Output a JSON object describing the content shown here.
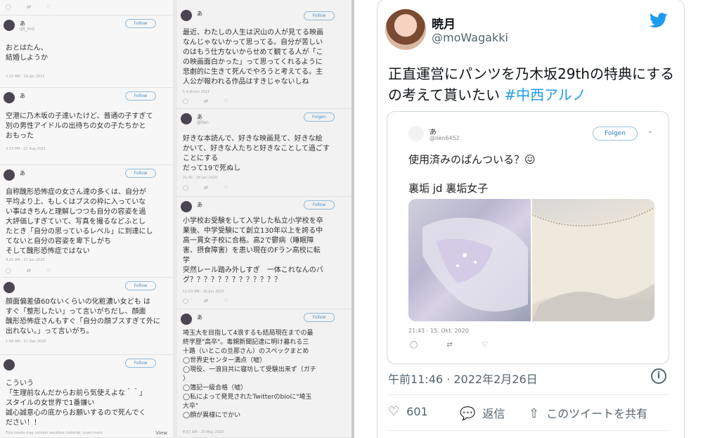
{
  "collage": {
    "col_a": [
      {
        "name": "あ",
        "handle": "@l_miz",
        "follow": "Follow",
        "text": "おとはたん、\n結婚しようか",
        "time": "2:22 AM - 19 Jan 2021"
      },
      {
        "name": "あ",
        "handle": "",
        "follow": "Follow",
        "text": "空港に乃木坂の子達いたけど、普通の子すぎて\n別の男性アイドルの出待ちの女の子たちかと\nおもった",
        "time": "3:13 PM - 22 Aug 2021"
      },
      {
        "name": "あ",
        "handle": "",
        "follow": "Follow",
        "text": "自称醜形恐怖症の女さん達の多くは、自分が\n平均より上、もしくはブスの枠に入っていな\nい事はきちんと理解しつつも自分の容姿を過\n大評価しすぎていて、写真を撮るなどふとし\nたとき「自分の思っているレベル」に到達にし\nてないと自分の容姿を卑下しがち\nそして醜形恐怖症ではない",
        "time": "9:25 AM - 17 Jun 2020"
      },
      {
        "name": "",
        "handle": "",
        "follow": "Follow",
        "text": "顔面偏差値60ないくらいの化粧濃い女ども は\nすぐ「整形したい」って言いがちだし、顔面\n醜形恐怖症さんもすぐ「自分の顔ブスすぎて外に\n出れない。」って言いがち。",
        "time": "1:58 AM - 21 Dec 2020"
      },
      {
        "name": "",
        "handle": "",
        "follow": "Follow",
        "text": "こういう\n「生理前なんだからお前ら気使えよな＾＾」\nスタイルの女世界で1番嫌い\n誠心誠意心の底からお願いするので死んでく\nださい！！",
        "time": "",
        "footer": "This media may contain sensitive material. Learn more",
        "footer_btn": "View"
      }
    ],
    "col_b": [
      {
        "name": "あ",
        "handle": "",
        "follow": "Follow",
        "text": "最近、わたしの人生は沢山の人が見てる映画\nなんじゃないかって思ってる。自分が苦しい\nのはもう仕方ないからせめて観てる人が「こ\nの映画面白かった」って思ってくれるように\n悲劇的に生きて死んでやろうと考えてる。主\n人公が報われる作品はすきじゃないしね",
        "time": "1:4 Amini 2021"
      },
      {
        "name": "あ",
        "handle": "@lien",
        "follow": "Folgen",
        "text": "好きな本読んで、好きな映画見て、好きな絵\nかいて、好きな人たちと好きなことして過ごす\nことにする\nだって19で死ぬし",
        "time": "21:41 · 20 Jan 2020"
      },
      {
        "name": "あ",
        "handle": "",
        "follow": "Follow",
        "text": "小学校お受験をして入学した私立小学校を卒\n業後、中学受験にて創立130年以上を誇る中\n高一貫女子校に合格。高2で鬱病（睡眠障\n害、摂食障害）を患い現在のFラン高校に転\n学\n突然レール踏み外しすぎ　一体これなんのバ\nグ？？？？？？？？？？？？？",
        "time": "11:53 AM - 26 Jun 2020"
      },
      {
        "name": "あ",
        "handle": "",
        "follow": "Follow",
        "text": "埼玉大を目指して4浪するも結局現在までの最\n終学歴\"高卒\"。毒親新聞記達に明け暮れる三\n十路（いとこの旦那さん）のスペックまとめ\n◯世界史センター満点（嘘）\n◯現役、一浪目共に寝坊して受験出来ず（ガチ\n）\n◯簿記一級合格（嘘）\n◯私によって発見されたTwitterのbioに\"埼玉\n大卒\"\n◯顔が異様にでかい",
        "time": "8:57 AM - 29 May 2020"
      }
    ]
  },
  "tweet": {
    "display_name": "暁月",
    "handle": "@moWagakki",
    "text_main": "正直運営にパンツを乃木坂29thの特典にするの考えて貰いたい",
    "hashtag": "#中西アルノ",
    "timestamp": "午前11:46 · 2022年2月26日",
    "info_label": "i",
    "likes": "601",
    "reply_label": "返信",
    "share_label": "このツイートを共有"
  },
  "quote": {
    "name": "あ",
    "handle": "@lien6452",
    "follow_label": "Folgen",
    "text1": "使用済みのぱんついる？😖",
    "text2": "裏垢 jd  裏垢女子",
    "time": "21:43 - 15. Okt. 2020"
  },
  "colors": {
    "accent": "#1d9bf0",
    "text_primary": "#0f1419",
    "text_secondary": "#536471",
    "border": "#cfd9de"
  },
  "icons": {
    "bird": "twitter-bird-icon",
    "heart": "heart-icon",
    "reply": "reply-icon",
    "share": "share-icon",
    "info": "info-icon"
  }
}
